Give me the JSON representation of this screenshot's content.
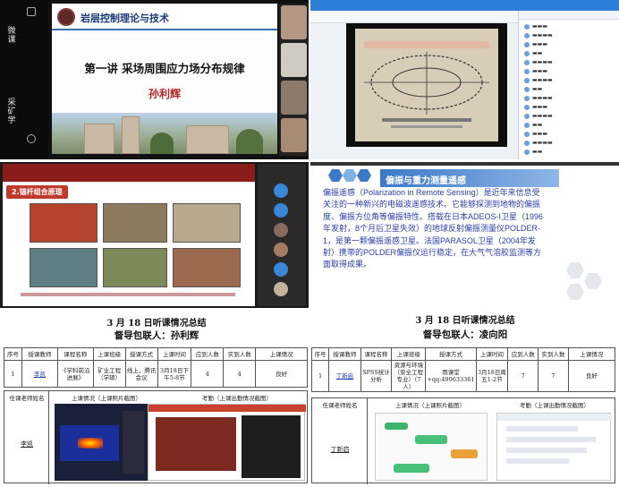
{
  "panel1": {
    "vertical_a": "微课",
    "vertical_b": "采矿学",
    "course_title": "岩层控制理论与技术",
    "lecture_title": "第一讲 采场周围应力场分布规律",
    "teacher": "孙利辉"
  },
  "panel3": {
    "section_tag": "2.锚杆组合原理"
  },
  "panel4": {
    "slide_title": "偏振与重力测量遥感",
    "body_text": "偏振遥感（Polarization in Remote Sensing）是近年来信息受关注的一种新兴的电磁波遥感技术。它能够探测到地物的偏振度、偏振方位角等偏振特性。搭载在日本ADEOS-I卫星（1996年发射，8个月后卫星失效）的地球反射偏振测量仪POLDER-1，是第一颗偏振遥感卫星。法国PARASOL卫星（2004年发射）携带的POLDER偏振仪运行稳定，在大气气溶胶监测等方面取得成果。"
  },
  "report_left": {
    "title": "3 月 18 日听课情况总结",
    "contact": "督导包联人：孙利辉",
    "headers": [
      "序号",
      "授课教师",
      "课程名称",
      "上课班级",
      "授课方式",
      "上课时间",
      "应到人数",
      "实到人数",
      "上课情况"
    ],
    "row": [
      "1",
      "李凯",
      "《学科前沿进展》",
      "矿业工程（学硕）",
      "线上，腾讯会议",
      "3月18日下午5-8节",
      "4",
      "4",
      "良好"
    ],
    "bottom_headers": [
      "任课老师姓名",
      "上课情况（上课照片截图）",
      "考勤（上课出勤情况截图）"
    ],
    "bottom_name": "李凯"
  },
  "report_right": {
    "title": "3 月 18 日听课情况总结",
    "contact": "督导包联人：凌向阳",
    "headers": [
      "序号",
      "授课教师",
      "课程名称",
      "上课班级",
      "授课方式",
      "上课时间",
      "应到人数",
      "实到人数",
      "上课情况"
    ],
    "row": [
      "1",
      "丁新启",
      "SPSS统计分析",
      "资源与环境（安全工程专业）（7人）",
      "雨课堂+qq:499633361",
      "3月18日周五1-2节",
      "7",
      "7",
      "良好"
    ],
    "bottom_headers": [
      "任课老师姓名",
      "上课情况（上课照片截图）",
      "考勤（上课出勤情况截图）"
    ],
    "bottom_name": "丁新启"
  }
}
